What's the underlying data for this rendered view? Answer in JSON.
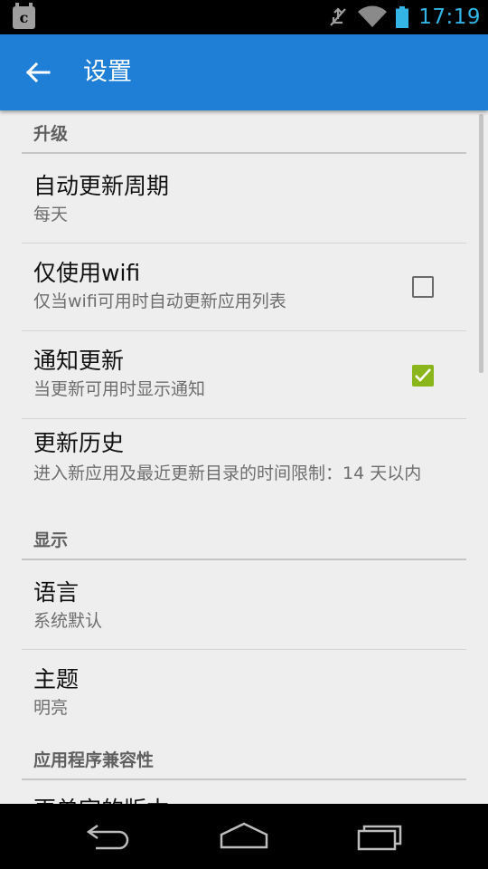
{
  "status_bar": {
    "time": "17:19",
    "notification_icon": "c",
    "icons": [
      "app-notification-icon",
      "mute-icon",
      "wifi-icon",
      "battery-icon"
    ]
  },
  "app_bar": {
    "title": "设置",
    "back_icon": "arrow-left-icon",
    "color": "#1f7fd6"
  },
  "sections": {
    "upgrade": {
      "header": "升级"
    },
    "display": {
      "header": "显示"
    },
    "compat": {
      "header": "应用程序兼容性"
    }
  },
  "prefs": {
    "update_interval": {
      "title": "自动更新周期",
      "summary": "每天"
    },
    "wifi_only": {
      "title": "仅使用wifi",
      "summary": "仅当wifi可用时自动更新应用列表",
      "checked": false
    },
    "notify": {
      "title": "通知更新",
      "summary": "当更新可用时显示通知",
      "checked": true
    },
    "history": {
      "title": "更新历史",
      "summary": "进入新应用及最近更新目录的时间限制：14 天以内"
    },
    "language": {
      "title": "语言",
      "summary": "系统默认"
    },
    "theme": {
      "title": "主题",
      "summary": "明亮"
    },
    "partial": {
      "title": "更单字的版本"
    }
  },
  "colors": {
    "accent": "#33b5e5",
    "checkbox_checked": "#8ab61c",
    "background": "#eeeeee"
  },
  "nav_bar": {
    "icons": [
      "back-icon",
      "home-icon",
      "recents-icon"
    ]
  }
}
